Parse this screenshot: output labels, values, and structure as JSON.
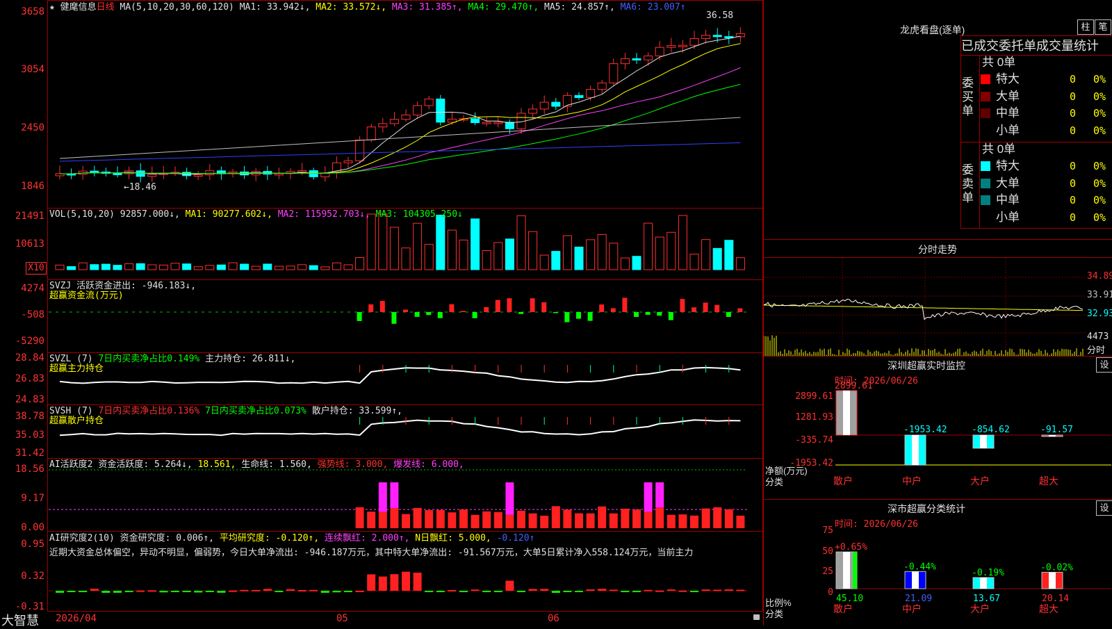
{
  "chart_header": {
    "star": "★",
    "stock_name": "健麾信息",
    "period": "日线",
    "ma_text": "MA(5,10,20,30,60,120)",
    "ma1": "MA1: 33.942↓,",
    "ma2": "MA2: 33.572↓,",
    "ma3": "MA3: 31.385↑,",
    "ma4": "MA4: 29.470↑,",
    "ma5": "MA5: 24.857↑,",
    "ma6": "MA6: 23.007↑",
    "high_label": "36.58",
    "low_label": "←18.46"
  },
  "price_axis": [
    "3658",
    "3054",
    "2450",
    "1846"
  ],
  "vol": {
    "title": "VOL(5,10,20)",
    "value": "92857.000↓,",
    "ma1": "MA1: 90277.602↓,",
    "ma2": "MA2: 115952.703↓,",
    "ma3": "MA3: 104305.250↓",
    "axis": [
      "21491",
      "10613"
    ],
    "unit": "X10"
  },
  "svzj": {
    "line1": "SVZJ  活跃资金进出: -946.183↓,",
    "line2": "超赢资金流(万元)",
    "axis": [
      "4274",
      "-508",
      "-5290"
    ]
  },
  "svzl": {
    "title": "SVZL (7)",
    "part1": "7日内买卖净占比0.149%",
    "part2": "主力持仓: 26.811↓,",
    "line2": "超赢主力持仓",
    "axis": [
      "28.84",
      "26.83",
      "24.83"
    ]
  },
  "svsh": {
    "title": "SVSH (7)",
    "part1": "7日内买卖净占比0.136%",
    "part2": "7日内买卖净占比0.073%",
    "part3": "散户持仓: 33.599↑,",
    "line2": "超赢散户持仓",
    "axis": [
      "38.78",
      "35.03",
      "31.42"
    ]
  },
  "ai1": {
    "title": "AI活跃度2",
    "p1": "资金活跃度: 5.264↓,",
    "p2": "18.561,",
    "p3": "生命线: 1.560,",
    "p4": "强势线: 3.000,",
    "p5": "爆发线: 6.000,",
    "axis": [
      "18.56",
      "9.17",
      "0.00"
    ]
  },
  "ai2": {
    "title": "AI研究度2(10)",
    "p1": "资金研究度: 0.006↑,",
    "p2": "平均研究度: -0.120↑,",
    "p3": "连续飘红: 2.000↑,",
    "p4": "N日飘红: 5.000,",
    "p5": "-0.120↑",
    "comment": "近期大资金总体偏空，异动不明显，偏弱势，今日大单净流出: -946.187万元，其中特大单净流出: -91.567万元，大单5日累计净入558.124万元，当前主力",
    "axis": [
      "0.95",
      "0.32",
      "-0.31"
    ]
  },
  "dates": [
    "2026/04",
    "05",
    "06"
  ],
  "brand": "大智慧",
  "longhu": {
    "title": "龙虎看盘(逐单)",
    "btn1": "柱",
    "btn2": "笔",
    "subtitle": "已成交委托单成交量统计",
    "buy_label": "委买单",
    "sell_label": "委卖单",
    "buy_total": "共 0单",
    "sell_total": "共 0单",
    "buy_rows": [
      {
        "name": "特大",
        "count": "0",
        "pct": "0%",
        "color": "#ff0000"
      },
      {
        "name": "大单",
        "count": "0",
        "pct": "0%",
        "color": "#800000"
      },
      {
        "name": "中单",
        "count": "0",
        "pct": "0%",
        "color": "#600000"
      },
      {
        "name": "小单",
        "count": "0",
        "pct": "0%",
        "color": "#000000"
      }
    ],
    "sell_rows": [
      {
        "name": "特大",
        "count": "0",
        "pct": "0%",
        "color": "#00ffff"
      },
      {
        "name": "大单",
        "count": "0",
        "pct": "0%",
        "color": "#008080"
      },
      {
        "name": "中单",
        "count": "0",
        "pct": "0%",
        "color": "#008080"
      },
      {
        "name": "小单",
        "count": "0",
        "pct": "0%",
        "color": "#000000"
      }
    ]
  },
  "fenshi": {
    "title": "分时走势",
    "axis": [
      "34.89",
      "33.91",
      "32.93",
      "4473",
      "分时"
    ]
  },
  "monitor": {
    "title": "深圳超赢实时监控",
    "btn": "设",
    "time": "时间: 2026/06/26",
    "axis": [
      "2899.61",
      "1281.93",
      "-335.74",
      "-1953.42"
    ],
    "ylabel": "净额(万元)",
    "xlabel": "分类",
    "bars": [
      {
        "cat": "散户",
        "value": "2899.61"
      },
      {
        "cat": "中户",
        "value": "-1953.42"
      },
      {
        "cat": "大户",
        "value": "-854.62"
      },
      {
        "cat": "超大",
        "value": "-91.57"
      }
    ]
  },
  "stats": {
    "title": "深市超赢分类统计",
    "btn": "设",
    "time": "时间: 2026/06/26",
    "axis": [
      "75",
      "50",
      "25",
      "0"
    ],
    "ylabel": "比例%",
    "xlabel": "分类",
    "bars": [
      {
        "cat": "散户",
        "ratio": "45.10",
        "change": "+0.65%"
      },
      {
        "cat": "中户",
        "ratio": "21.09",
        "change": "-0.44%"
      },
      {
        "cat": "大户",
        "ratio": "13.67",
        "change": "-0.19%"
      },
      {
        "cat": "超大",
        "ratio": "20.14",
        "change": "-0.02%"
      }
    ]
  }
}
